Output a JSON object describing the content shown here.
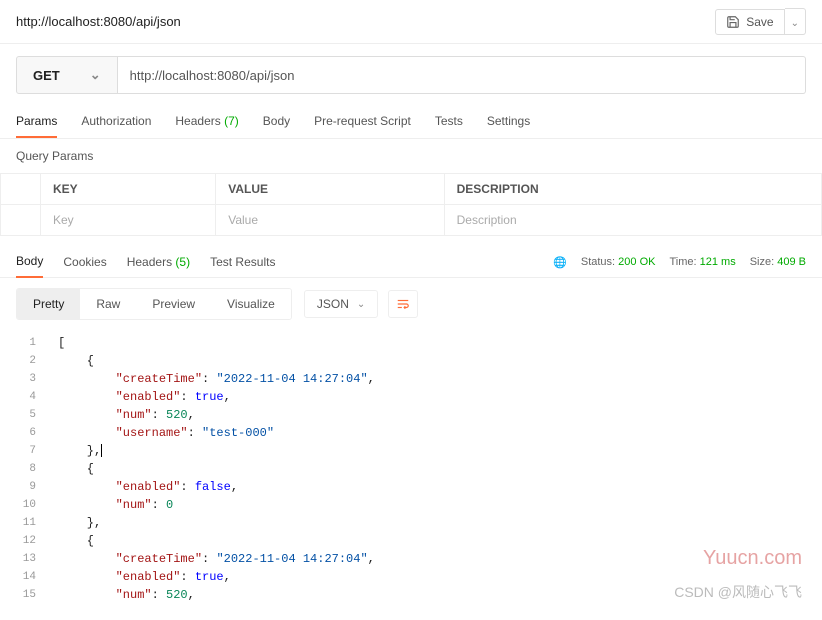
{
  "header": {
    "title": "http://localhost:8080/api/json",
    "save_label": "Save"
  },
  "request": {
    "method": "GET",
    "url": "http://localhost:8080/api/json"
  },
  "req_tabs": {
    "params": "Params",
    "auth": "Authorization",
    "headers": "Headers",
    "headers_count": "(7)",
    "body": "Body",
    "prereq": "Pre-request Script",
    "tests": "Tests",
    "settings": "Settings"
  },
  "query_params": {
    "title": "Query Params",
    "cols": {
      "key": "KEY",
      "value": "VALUE",
      "desc": "DESCRIPTION"
    },
    "placeholders": {
      "key": "Key",
      "value": "Value",
      "desc": "Description"
    }
  },
  "resp_tabs": {
    "body": "Body",
    "cookies": "Cookies",
    "headers": "Headers",
    "headers_count": "(5)",
    "tests": "Test Results"
  },
  "resp_meta": {
    "status_label": "Status:",
    "status_value": "200 OK",
    "time_label": "Time:",
    "time_value": "121 ms",
    "size_label": "Size:",
    "size_value": "409 B"
  },
  "viewbar": {
    "pretty": "Pretty",
    "raw": "Raw",
    "preview": "Preview",
    "visualize": "Visualize",
    "format": "JSON"
  },
  "code_lines": [
    {
      "n": 1,
      "tokens": [
        [
          "p",
          "["
        ]
      ]
    },
    {
      "n": 2,
      "tokens": [
        [
          "p",
          "    {"
        ]
      ]
    },
    {
      "n": 3,
      "tokens": [
        [
          "p",
          "        "
        ],
        [
          "k",
          "\"createTime\""
        ],
        [
          "p",
          ": "
        ],
        [
          "s",
          "\"2022-11-04 14:27:04\""
        ],
        [
          "p",
          ","
        ]
      ]
    },
    {
      "n": 4,
      "tokens": [
        [
          "p",
          "        "
        ],
        [
          "k",
          "\"enabled\""
        ],
        [
          "p",
          ": "
        ],
        [
          "b",
          "true"
        ],
        [
          "p",
          ","
        ]
      ]
    },
    {
      "n": 5,
      "tokens": [
        [
          "p",
          "        "
        ],
        [
          "k",
          "\"num\""
        ],
        [
          "p",
          ": "
        ],
        [
          "n",
          "520"
        ],
        [
          "p",
          ","
        ]
      ]
    },
    {
      "n": 6,
      "tokens": [
        [
          "p",
          "        "
        ],
        [
          "k",
          "\"username\""
        ],
        [
          "p",
          ": "
        ],
        [
          "s",
          "\"test-000\""
        ]
      ]
    },
    {
      "n": 7,
      "tokens": [
        [
          "p",
          "    },"
        ],
        [
          "caret",
          ""
        ]
      ]
    },
    {
      "n": 8,
      "tokens": [
        [
          "p",
          "    {"
        ]
      ]
    },
    {
      "n": 9,
      "tokens": [
        [
          "p",
          "        "
        ],
        [
          "k",
          "\"enabled\""
        ],
        [
          "p",
          ": "
        ],
        [
          "b",
          "false"
        ],
        [
          "p",
          ","
        ]
      ]
    },
    {
      "n": 10,
      "tokens": [
        [
          "p",
          "        "
        ],
        [
          "k",
          "\"num\""
        ],
        [
          "p",
          ": "
        ],
        [
          "n",
          "0"
        ]
      ]
    },
    {
      "n": 11,
      "tokens": [
        [
          "p",
          "    },"
        ]
      ]
    },
    {
      "n": 12,
      "tokens": [
        [
          "p",
          "    {"
        ]
      ]
    },
    {
      "n": 13,
      "tokens": [
        [
          "p",
          "        "
        ],
        [
          "k",
          "\"createTime\""
        ],
        [
          "p",
          ": "
        ],
        [
          "s",
          "\"2022-11-04 14:27:04\""
        ],
        [
          "p",
          ","
        ]
      ]
    },
    {
      "n": 14,
      "tokens": [
        [
          "p",
          "        "
        ],
        [
          "k",
          "\"enabled\""
        ],
        [
          "p",
          ": "
        ],
        [
          "b",
          "true"
        ],
        [
          "p",
          ","
        ]
      ]
    },
    {
      "n": 15,
      "tokens": [
        [
          "p",
          "        "
        ],
        [
          "k",
          "\"num\""
        ],
        [
          "p",
          ": "
        ],
        [
          "n",
          "520"
        ],
        [
          "p",
          ","
        ]
      ]
    }
  ],
  "watermarks": {
    "w1": "Yuucn.com",
    "w2": "CSDN @风随心飞飞"
  }
}
